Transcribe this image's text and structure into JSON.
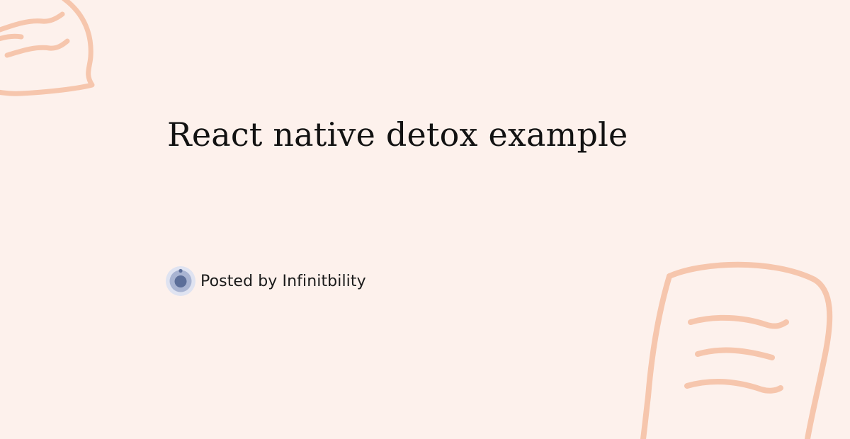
{
  "post": {
    "title": "React native detox example",
    "byline": "Posted by Infinitbility"
  },
  "colors": {
    "background": "#fdf1ec",
    "decoration": "#f6c6ad",
    "avatar_outer": "#dfe3f1",
    "avatar_mid": "#a9b4d2",
    "avatar_inner": "#5c6e99"
  },
  "icons": {
    "avatar": "avatar-logo",
    "decorations": [
      "chat-bubble-doodle",
      "chat-bubble-doodle"
    ]
  }
}
